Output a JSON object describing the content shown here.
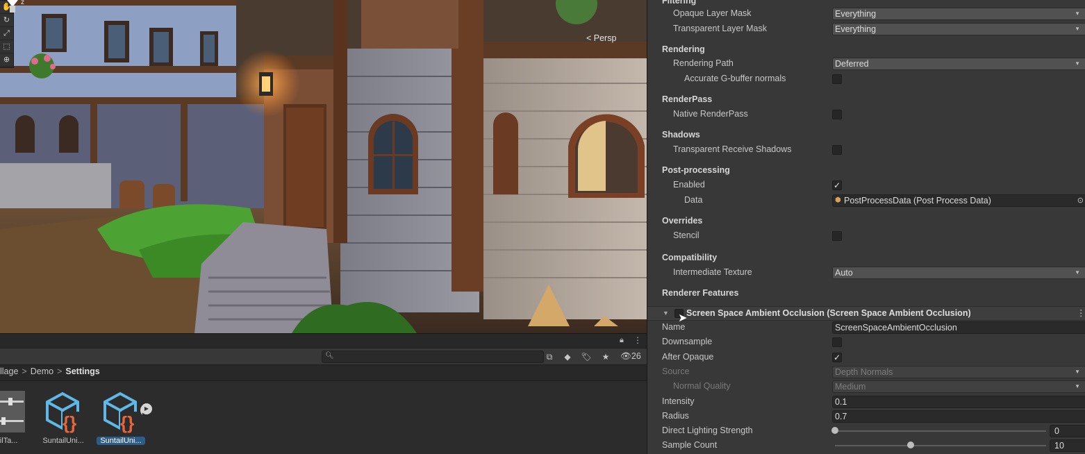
{
  "scene": {
    "persp_label": "< Persp",
    "gizmo_axis_label": "z",
    "tools": [
      "✋",
      "↻",
      "⤢",
      "⬚",
      "⊕"
    ]
  },
  "project": {
    "visible_count": "26",
    "breadcrumb": [
      "llage",
      "Demo",
      "Settings"
    ],
    "assets": [
      {
        "label": "ntailTa...",
        "icon": "slider-settings-icon",
        "selected": false
      },
      {
        "label": "SuntailUni...",
        "icon": "script-cube-icon",
        "selected": false
      },
      {
        "label": "SuntailUni...",
        "icon": "script-cube-play-icon",
        "selected": true
      }
    ]
  },
  "inspector": {
    "filtering_header": "Filtering",
    "opaque_layer_mask": {
      "label": "Opaque Layer Mask",
      "value": "Everything"
    },
    "transparent_layer_mask": {
      "label": "Transparent Layer Mask",
      "value": "Everything"
    },
    "rendering_header": "Rendering",
    "rendering_path": {
      "label": "Rendering Path",
      "value": "Deferred"
    },
    "accurate_gbuffer": {
      "label": "Accurate G-buffer normals",
      "checked": false
    },
    "renderpass_header": "RenderPass",
    "native_renderpass": {
      "label": "Native RenderPass",
      "checked": false
    },
    "shadows_header": "Shadows",
    "transparent_receive_shadows": {
      "label": "Transparent Receive Shadows",
      "checked": false
    },
    "postprocessing_header": "Post-processing",
    "pp_enabled": {
      "label": "Enabled",
      "checked": true
    },
    "pp_data": {
      "label": "Data",
      "value": "PostProcessData (Post Process Data)"
    },
    "overrides_header": "Overrides",
    "stencil": {
      "label": "Stencil",
      "checked": false
    },
    "compatibility_header": "Compatibility",
    "intermediate_texture": {
      "label": "Intermediate Texture",
      "value": "Auto"
    },
    "renderer_features_header": "Renderer Features",
    "feature": {
      "title": "Screen Space Ambient Occlusion (Screen Space Ambient Occlusion)",
      "name": {
        "label": "Name",
        "value": "ScreenSpaceAmbientOcclusion"
      },
      "downsample": {
        "label": "Downsample",
        "checked": false
      },
      "after_opaque": {
        "label": "After Opaque",
        "checked": true
      },
      "source": {
        "label": "Source",
        "value": "Depth Normals"
      },
      "normal_quality": {
        "label": "Normal Quality",
        "value": "Medium"
      },
      "intensity": {
        "label": "Intensity",
        "value": "0.1"
      },
      "radius": {
        "label": "Radius",
        "value": "0.7"
      },
      "direct_lighting_strength": {
        "label": "Direct Lighting Strength",
        "value": "0",
        "fraction": 0.0
      },
      "sample_count": {
        "label": "Sample Count",
        "value": "10",
        "fraction": 0.36
      }
    }
  }
}
